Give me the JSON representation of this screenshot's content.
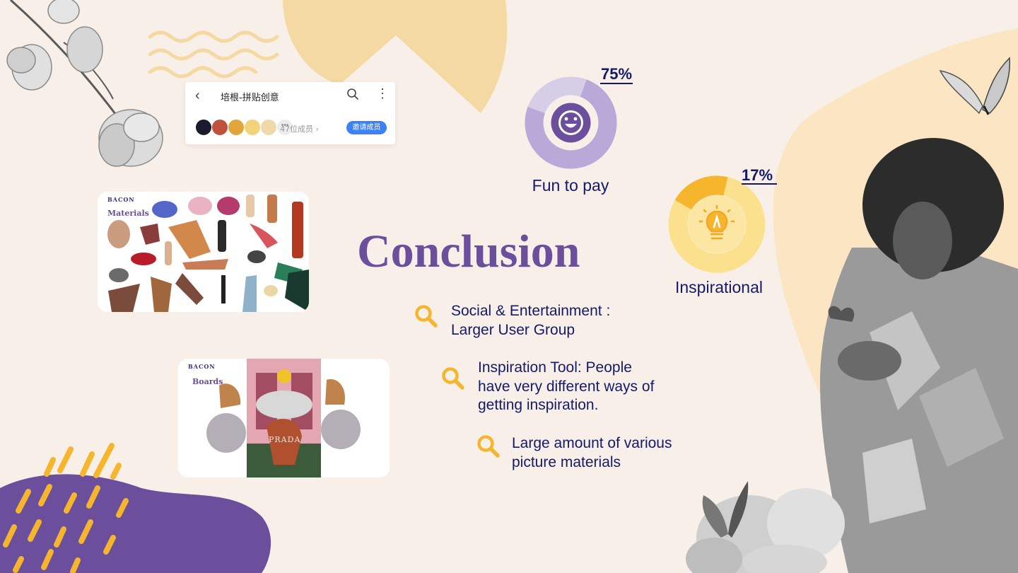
{
  "slide": {
    "title": "Conclusion",
    "colors": {
      "purple": "#6b4e9c",
      "navy": "#15196b",
      "yellow": "#f5b62e",
      "cream": "#f8f0e8"
    }
  },
  "app_mock": {
    "back_icon": "chevron-left-icon",
    "group_name": "培根-拼贴创意",
    "search_icon": "search-icon",
    "more_icon": "more-vertical-icon",
    "member_count": "47位成员 ›",
    "invite_label": "邀请成员"
  },
  "materials_card": {
    "logo": "BACON",
    "heading": "Materials"
  },
  "boards_card": {
    "logo": "BACON",
    "heading": "Boards",
    "brand": "PRADA"
  },
  "stats": [
    {
      "value": "75%",
      "label": "Fun to pay",
      "icon": "smiley-icon"
    },
    {
      "value": "17%",
      "label": "Inspirational",
      "icon": "lightbulb-icon"
    }
  ],
  "points": [
    {
      "line1": "Social & Entertainment :",
      "line2": "Larger User Group"
    },
    {
      "line1": "Inspiration Tool: People",
      "line2": "have very different ways of",
      "line3": "getting inspiration."
    },
    {
      "line1": "Large amount of various",
      "line2": "picture materials"
    }
  ]
}
